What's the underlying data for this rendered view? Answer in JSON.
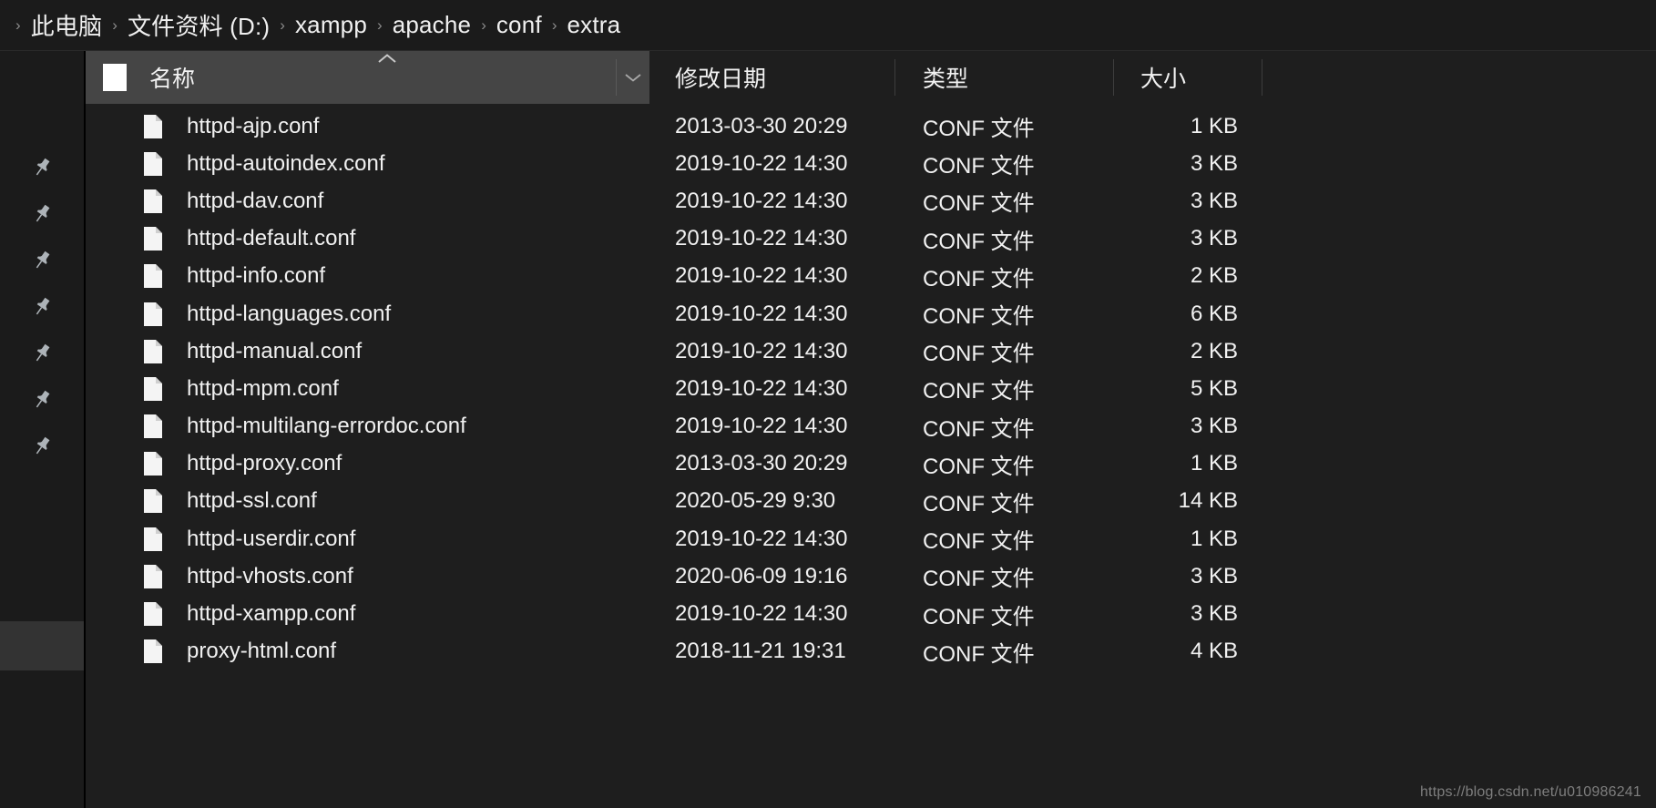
{
  "breadcrumb": {
    "leading_separator": "›",
    "separator": "›",
    "items": [
      {
        "label": "此电脑"
      },
      {
        "label": "文件资料 (D:)"
      },
      {
        "label": "xampp"
      },
      {
        "label": "apache"
      },
      {
        "label": "conf"
      },
      {
        "label": "extra"
      }
    ]
  },
  "sidebar": {
    "pin_icon_name": "pushpin-icon",
    "pin_count": 7,
    "highlight_color": "#333333"
  },
  "columns": {
    "name": "名称",
    "date_modified": "修改日期",
    "type": "类型",
    "size": "大小",
    "sort_indicator": "ascending",
    "sort_caret_icon": "chevron-up-icon",
    "dropdown_icon": "chevron-down-icon",
    "select_all_checked": false
  },
  "files": [
    {
      "name": "httpd-ajp.conf",
      "date": "2013-03-30 20:29",
      "type": "CONF 文件",
      "size": "1 KB"
    },
    {
      "name": "httpd-autoindex.conf",
      "date": "2019-10-22 14:30",
      "type": "CONF 文件",
      "size": "3 KB"
    },
    {
      "name": "httpd-dav.conf",
      "date": "2019-10-22 14:30",
      "type": "CONF 文件",
      "size": "3 KB"
    },
    {
      "name": "httpd-default.conf",
      "date": "2019-10-22 14:30",
      "type": "CONF 文件",
      "size": "3 KB"
    },
    {
      "name": "httpd-info.conf",
      "date": "2019-10-22 14:30",
      "type": "CONF 文件",
      "size": "2 KB"
    },
    {
      "name": "httpd-languages.conf",
      "date": "2019-10-22 14:30",
      "type": "CONF 文件",
      "size": "6 KB"
    },
    {
      "name": "httpd-manual.conf",
      "date": "2019-10-22 14:30",
      "type": "CONF 文件",
      "size": "2 KB"
    },
    {
      "name": "httpd-mpm.conf",
      "date": "2019-10-22 14:30",
      "type": "CONF 文件",
      "size": "5 KB"
    },
    {
      "name": "httpd-multilang-errordoc.conf",
      "date": "2019-10-22 14:30",
      "type": "CONF 文件",
      "size": "3 KB"
    },
    {
      "name": "httpd-proxy.conf",
      "date": "2013-03-30 20:29",
      "type": "CONF 文件",
      "size": "1 KB"
    },
    {
      "name": "httpd-ssl.conf",
      "date": "2020-05-29 9:30",
      "type": "CONF 文件",
      "size": "14 KB"
    },
    {
      "name": "httpd-userdir.conf",
      "date": "2019-10-22 14:30",
      "type": "CONF 文件",
      "size": "1 KB"
    },
    {
      "name": "httpd-vhosts.conf",
      "date": "2020-06-09 19:16",
      "type": "CONF 文件",
      "size": "3 KB"
    },
    {
      "name": "httpd-xampp.conf",
      "date": "2019-10-22 14:30",
      "type": "CONF 文件",
      "size": "3 KB"
    },
    {
      "name": "proxy-html.conf",
      "date": "2018-11-21 19:31",
      "type": "CONF 文件",
      "size": "4 KB"
    }
  ],
  "watermark": "https://blog.csdn.net/u010986241"
}
